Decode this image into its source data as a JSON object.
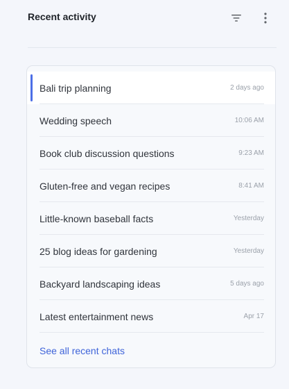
{
  "header": {
    "title": "Recent activity",
    "filter_icon": "filter-icon",
    "more_icon": "more-vertical-icon"
  },
  "activity": {
    "items": [
      {
        "title": "Bali trip planning",
        "time": "2 days ago",
        "selected": true
      },
      {
        "title": "Wedding speech",
        "time": "10:06 AM"
      },
      {
        "title": "Book club discussion questions",
        "time": "9:23 AM"
      },
      {
        "title": "Gluten-free and vegan recipes",
        "time": "8:41 AM"
      },
      {
        "title": "Little-known baseball facts",
        "time": "Yesterday"
      },
      {
        "title": "25 blog ideas for gardening",
        "time": "Yesterday"
      },
      {
        "title": "Backyard landscaping ideas",
        "time": "5 days ago"
      },
      {
        "title": "Latest entertainment news",
        "time": "Apr 17"
      }
    ],
    "see_all_label": "See all recent chats"
  },
  "colors": {
    "accent": "#4c6ee6",
    "link": "#3f64d9",
    "background": "#f4f6fb"
  }
}
